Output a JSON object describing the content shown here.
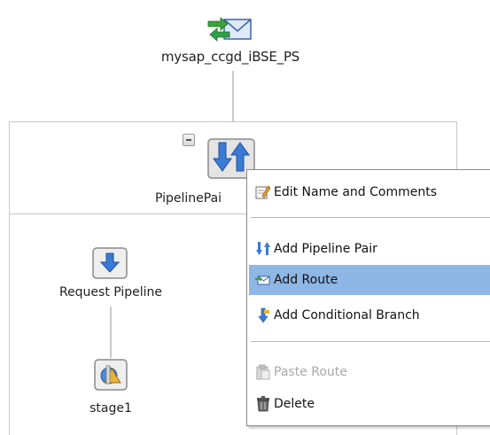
{
  "proxy": {
    "label": "mysap_ccgd_iBSE_PS"
  },
  "pipeline_pair": {
    "label": "PipelinePai"
  },
  "request_pipeline": {
    "label": "Request Pipeline"
  },
  "stage": {
    "label": "stage1"
  },
  "context_menu": {
    "items": [
      {
        "label": "Edit Name and Comments",
        "icon": "edit-icon",
        "state": "normal"
      },
      {
        "label": "Add Pipeline Pair",
        "icon": "pipeline-pair-icon",
        "state": "normal"
      },
      {
        "label": "Add Route",
        "icon": "route-icon",
        "state": "highlighted"
      },
      {
        "label": "Add Conditional Branch",
        "icon": "branch-icon",
        "state": "normal"
      },
      {
        "label": "Paste Route",
        "icon": "paste-icon",
        "state": "disabled"
      },
      {
        "label": "Delete",
        "icon": "trash-icon",
        "state": "normal"
      }
    ]
  },
  "colors": {
    "menu_highlight": "#8eb7e6",
    "arrow_green": "#3aa33a",
    "arrow_blue": "#2f6fd1",
    "box_border": "#c8c8c8"
  }
}
